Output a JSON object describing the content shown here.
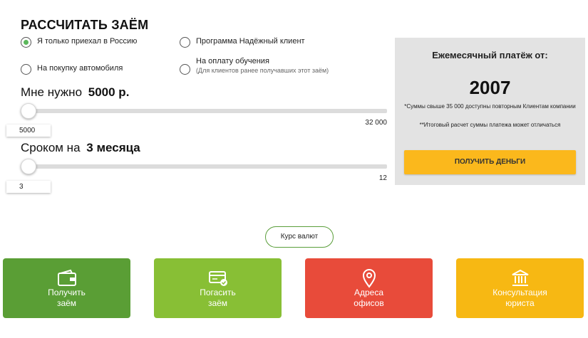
{
  "calc": {
    "title": "РАССЧИТАТЬ ЗАЁМ",
    "options": [
      {
        "label": "Я только приехал в Россию",
        "selected": true
      },
      {
        "label": "Программа Надёжный клиент",
        "selected": false
      },
      {
        "label": "На покупку автомобиля",
        "selected": false
      },
      {
        "label": "На оплату обучения",
        "sub": "(Для клиентов ранее получавших этот заём)",
        "selected": false
      }
    ],
    "amount": {
      "label": "Мне нужно",
      "value_text": "5000 р.",
      "input_value": "5000",
      "max_label": "32 000",
      "level": 0
    },
    "term": {
      "label": "Сроком на",
      "value_text": "3 месяца",
      "input_value": "3",
      "max_label": "12",
      "level": 0
    }
  },
  "payment_panel": {
    "title": "Ежемесячный платёж от:",
    "amount": "2007",
    "note1": "*Суммы свыше 35 000 доступны повторным Клиентам компании",
    "note2": "**Итоговый расчет суммы платежа может отличаться",
    "button_label": "ПОЛУЧИТЬ ДЕНЬГИ",
    "button_color": "#fbb81c"
  },
  "currency_button": "Курс валют",
  "tiles": [
    {
      "line1": "Получить",
      "line2": "заём",
      "icon": "wallet-icon",
      "color": "#5a9e35"
    },
    {
      "line1": "Погасить",
      "line2": "заём",
      "icon": "card-check-icon",
      "color": "#88bf35"
    },
    {
      "line1": "Адреса",
      "line2": "офисов",
      "icon": "location-pin-icon",
      "color": "#e84b3a"
    },
    {
      "line1": "Консультация",
      "line2": "юриста",
      "icon": "bank-building-icon",
      "color": "#f7b813"
    }
  ]
}
